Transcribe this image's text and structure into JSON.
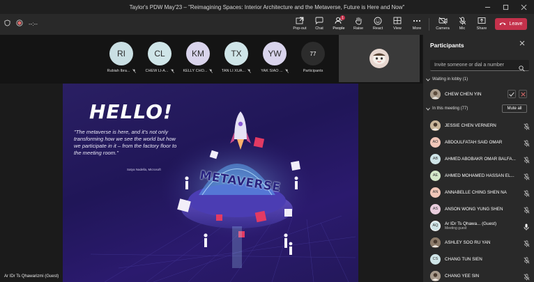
{
  "window": {
    "title": "Taylor's PDW May'23 – \"Reimagining Spaces: Interior Architecture and the Metaverse, Future is Here and Now\"",
    "controls": [
      "minimize-icon",
      "maximize-icon",
      "close-icon"
    ]
  },
  "toolbar": {
    "timer": "--:--",
    "buttons": [
      {
        "name": "popout",
        "label": "Pop-out",
        "icon": "popout-icon"
      },
      {
        "name": "chat",
        "label": "Chat",
        "icon": "chat-icon"
      },
      {
        "name": "people",
        "label": "People",
        "icon": "people-icon",
        "badge": "1"
      },
      {
        "name": "raise",
        "label": "Raise",
        "icon": "hand-icon"
      },
      {
        "name": "react",
        "label": "React",
        "icon": "smile-icon"
      },
      {
        "name": "view",
        "label": "View",
        "icon": "grid-icon"
      },
      {
        "name": "more",
        "label": "More",
        "icon": "more-icon"
      },
      {
        "name": "camera",
        "label": "Camera",
        "icon": "camera-off-icon"
      },
      {
        "name": "mic",
        "label": "Mic",
        "icon": "mic-off-icon"
      },
      {
        "name": "share",
        "label": "Share",
        "icon": "share-icon"
      }
    ],
    "leave_label": "Leave",
    "accent": "#7f85f5",
    "leave_color": "#c4314b"
  },
  "gallery": {
    "tiles": [
      {
        "initials": "RI",
        "name": "Rubiah Ibra...",
        "color": "#c9dfe3"
      },
      {
        "initials": "CL",
        "name": "CHEW LI-A...",
        "color": "#cfe5e8"
      },
      {
        "initials": "KM",
        "name": "KELLY CHO...",
        "color": "#d9d4ec"
      },
      {
        "initials": "TX",
        "name": "TAN LI XUA...",
        "color": "#cfe5e8"
      },
      {
        "initials": "YW",
        "name": "YAK SIAO ...",
        "color": "#d9d4ec"
      }
    ],
    "participants_count": "77",
    "participants_label": "Participants"
  },
  "slide": {
    "hello": "HELLO!",
    "quote": "\"The metaverse is here, and it's not only transforming how we see the world but how we participate in it – from the factory floor to the meeting room.\"",
    "citation": "Satya Nadella, Microsoft",
    "metaverse_word": "METAVERSE"
  },
  "stage": {
    "presenter_name": "Ar IDr Ts Qhawarizmi (Guest)"
  },
  "panel": {
    "title": "Participants",
    "invite_placeholder": "Invite someone or dial a number",
    "lobby_header": "Waiting in lobby (1)",
    "lobby": [
      {
        "name": "CHEW CHEN YIN"
      }
    ],
    "meeting_header": "In this meeting (77)",
    "mute_all_label": "Mute all",
    "participants": [
      {
        "initials": "",
        "name": "JESSIE CHEN VERNERN",
        "sub": "",
        "color": "#c8b59a",
        "photo": true
      },
      {
        "initials": "AO",
        "name": "ABDOULFATAH SAID OMAR",
        "sub": "",
        "color": "#f1c7b9"
      },
      {
        "initials": "AB",
        "name": "AHMED ABOBAKR OMAR BALFA...",
        "sub": "",
        "color": "#cfe5e8"
      },
      {
        "initials": "AE",
        "name": "AHMED MOHAMED HASSAN EL...",
        "sub": "",
        "color": "#d5e8c9"
      },
      {
        "initials": "AN",
        "name": "ANNABELLE CHING SHEN NA",
        "sub": "",
        "color": "#f1c7b9"
      },
      {
        "initials": "AS",
        "name": "ANSON WONG YUNG SHEN",
        "sub": "",
        "color": "#e9cddd"
      },
      {
        "initials": "AQ",
        "name": "Ar IDr Ts Qhawa... (Guest)",
        "sub": "Meeting guest",
        "color": "#cfe5e8"
      },
      {
        "initials": "",
        "name": "ASHLEY SOO RU YAN",
        "sub": "",
        "color": "#8c7b6a",
        "photo": true
      },
      {
        "initials": "CS",
        "name": "CHANG TUN SIEN",
        "sub": "",
        "color": "#cfe5e8"
      },
      {
        "initials": "",
        "name": "CHANG YEE SIN",
        "sub": "",
        "color": "#a79a8c",
        "photo": true
      }
    ]
  }
}
